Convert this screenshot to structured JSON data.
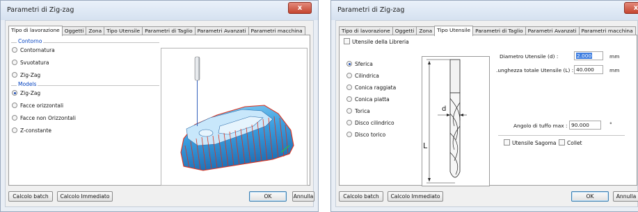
{
  "dlg1": {
    "title": "Parametri di Zig-zag",
    "close_label": "x",
    "tabs": [
      "Tipo di lavorazione",
      "Oggetti",
      "Zona",
      "Tipo Utensile",
      "Parametri di Taglio",
      "Parametri Avanzati",
      "Parametri macchina"
    ],
    "contorno_label": "Contorno",
    "contorno_options": [
      "Contornatura",
      "Svuotatura",
      "Zig-Zag"
    ],
    "models_label": "Models",
    "models_options": [
      "Zig-Zag",
      "Facce orizzontali",
      "Facce non Orizzontali",
      "Z-constante"
    ],
    "selected_option": "Zig-Zag",
    "btn_batch": "Calcolo batch",
    "btn_immediato": "Calcolo Immediato",
    "btn_ok": "OK",
    "btn_annulla": "Annulla"
  },
  "dlg2": {
    "title": "Parametri di Zig-zag",
    "tabs": [
      "Tipo di lavorazione",
      "Oggetti",
      "Zona",
      "Tipo Utensile",
      "Parametri di Taglio",
      "Parametri Avanzati",
      "Parametri macchina"
    ],
    "library_label": "Utensile della Libreria",
    "tool_types": [
      "Sferica",
      "Cilindrica",
      "Conica raggiata",
      "Conica piatta",
      "Torica",
      "Disco cilindrico",
      "Disco torico"
    ],
    "selected_tool": "Sferica",
    "diam_label": "Diametro Utensile (d) :",
    "diam_value": "2.000",
    "len_label": ".unghezza totale Utensile (L) :",
    "len_value": "40.000",
    "unit_mm": "mm",
    "angle_label": "Angolo di tuffo max :",
    "angle_value": "90.000",
    "angle_unit": "°",
    "sagoma_label": "Utensile Sagoma",
    "collet_label": "Collet",
    "dim_d": "d",
    "dim_L": "L",
    "btn_batch": "Calcolo batch",
    "btn_immediato": "Calcolo Immediato",
    "btn_ok": "OK",
    "btn_annulla": "Annulla"
  },
  "colors": {
    "accent": "#1f4fb5",
    "group_label": "#0040c0",
    "toolpath": "#e0301a",
    "model": "#3a9fe0",
    "close": "#c44530"
  }
}
